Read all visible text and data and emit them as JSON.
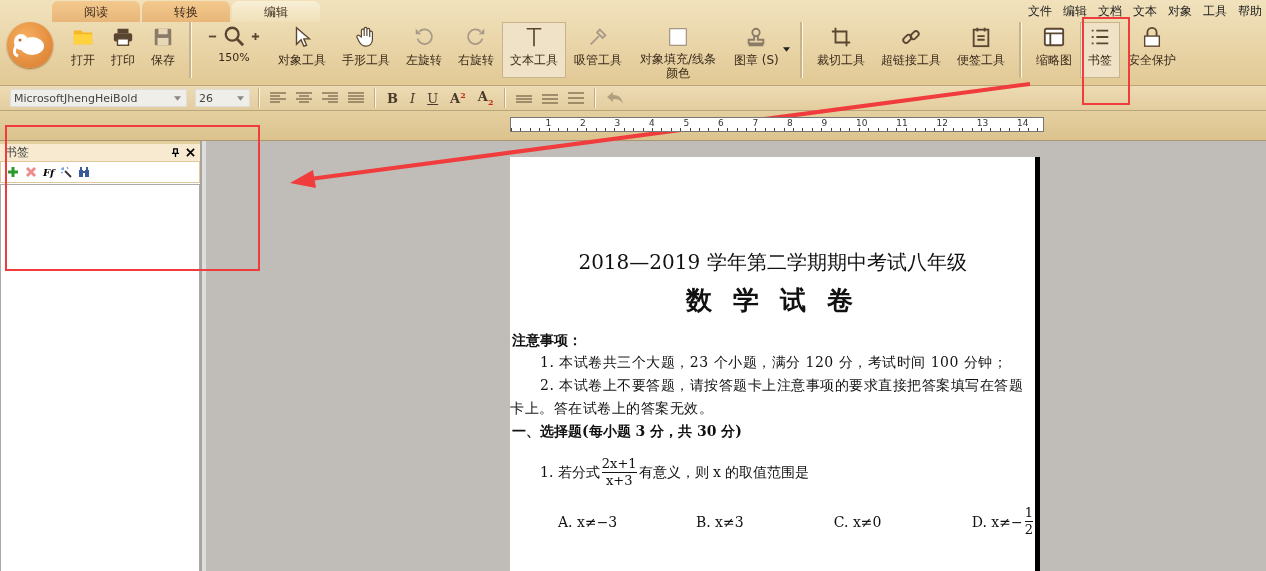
{
  "tabs": [
    {
      "label": "阅读",
      "selected": false
    },
    {
      "label": "转换",
      "selected": false
    },
    {
      "label": "编辑",
      "selected": true
    }
  ],
  "menu": [
    "文件",
    "编辑",
    "文档",
    "文本",
    "对象",
    "工具",
    "帮助"
  ],
  "toolbar": {
    "file_buttons": [
      {
        "label": "打开"
      },
      {
        "label": "打印"
      },
      {
        "label": "保存"
      }
    ],
    "zoom": {
      "value": "150%"
    },
    "tool_buttons": [
      {
        "label": "对象工具",
        "selected": false
      },
      {
        "label": "手形工具",
        "selected": false
      },
      {
        "label": "左旋转",
        "selected": false
      },
      {
        "label": "右旋转",
        "selected": false
      },
      {
        "label": "文本工具",
        "selected": true
      },
      {
        "label": "吸管工具",
        "selected": false
      },
      {
        "label": "对象填充/线条颜色",
        "selected": false
      },
      {
        "label": "图章 (S)",
        "selected": false
      }
    ],
    "edit_buttons": [
      {
        "label": "裁切工具"
      },
      {
        "label": "超链接工具"
      },
      {
        "label": "便签工具"
      }
    ],
    "view_buttons": [
      {
        "label": "缩略图",
        "selected": false
      },
      {
        "label": "书签",
        "selected": true
      },
      {
        "label": "安全保护",
        "selected": false
      }
    ]
  },
  "format_bar": {
    "font": "MicrosoftJhengHeiBold",
    "size": "26",
    "style_buttons": [
      "B",
      "I",
      "U",
      "A$^{2}$",
      "A$_{2}$"
    ]
  },
  "ruler": [
    "1",
    "2",
    "3",
    "4",
    "5",
    "6",
    "7",
    "8",
    "9",
    "10",
    "11",
    "12",
    "13",
    "14"
  ],
  "bookmark_panel": {
    "title": "书签",
    "format_label": "Ff"
  },
  "document": {
    "title": "2018—2019 学年第二学期期中考试八年级",
    "subtitle": "数 学 试 卷",
    "notes_heading": "注意事项：",
    "notes": [
      "1. 本试卷共三个大题，23 个小题，满分 120 分，考试时间 100 分钟；",
      "2. 本试卷上不要答题，请按答题卡上注意事项的要求直接把答案填写在答题卡上。答在试卷上的答案无效。"
    ],
    "section_heading": "一、选择题(每小题 3 分，共 30 分)",
    "question": {
      "number": "1.",
      "before": "若分式",
      "numerator": "2x+1",
      "denominator": "x+3",
      "after": "有意义，则 x 的取值范围是"
    },
    "options": [
      {
        "label": "A. x≠−3"
      },
      {
        "label": "B. x≠3"
      },
      {
        "label": "C. x≠0"
      },
      {
        "label": "D. x≠−",
        "numerator": "1",
        "denominator": "2"
      }
    ]
  }
}
